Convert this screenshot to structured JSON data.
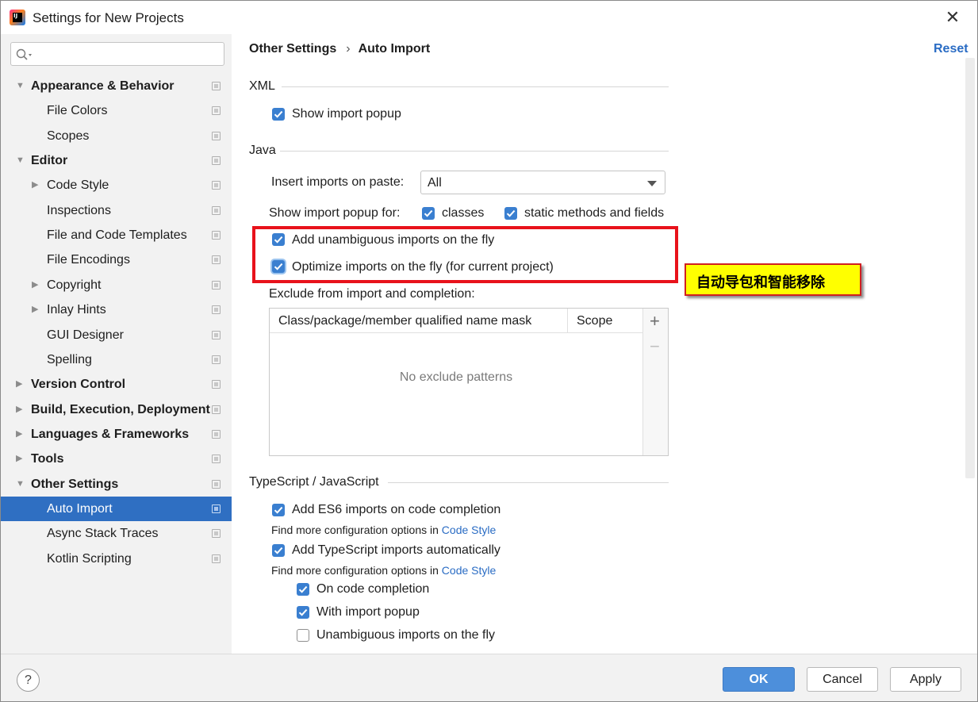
{
  "window": {
    "title": "Settings for New Projects",
    "close_glyph": "✕",
    "app_icon_text": "IJ"
  },
  "sidebar": {
    "search_placeholder": "",
    "items": [
      {
        "label": "Appearance & Behavior",
        "level": 0,
        "expanded": true
      },
      {
        "label": "File Colors",
        "level": 1
      },
      {
        "label": "Scopes",
        "level": 1
      },
      {
        "label": "Editor",
        "level": 0,
        "expanded": true
      },
      {
        "label": "Code Style",
        "level": 1,
        "collapsed": true
      },
      {
        "label": "Inspections",
        "level": 1
      },
      {
        "label": "File and Code Templates",
        "level": 1
      },
      {
        "label": "File Encodings",
        "level": 1
      },
      {
        "label": "Copyright",
        "level": 1,
        "collapsed": true
      },
      {
        "label": "Inlay Hints",
        "level": 1,
        "collapsed": true
      },
      {
        "label": "GUI Designer",
        "level": 1
      },
      {
        "label": "Spelling",
        "level": 1
      },
      {
        "label": "Version Control",
        "level": 0,
        "collapsed": true
      },
      {
        "label": "Build, Execution, Deployment",
        "level": 0,
        "collapsed": true
      },
      {
        "label": "Languages & Frameworks",
        "level": 0,
        "collapsed": true
      },
      {
        "label": "Tools",
        "level": 0,
        "collapsed": true
      },
      {
        "label": "Other Settings",
        "level": 0,
        "expanded": true
      },
      {
        "label": "Auto Import",
        "level": 1,
        "selected": true
      },
      {
        "label": "Async Stack Traces",
        "level": 1
      },
      {
        "label": "Kotlin Scripting",
        "level": 1
      }
    ]
  },
  "header": {
    "breadcrumb_parent": "Other Settings",
    "breadcrumb_sep": "›",
    "breadcrumb_current": "Auto Import",
    "reset_label": "Reset"
  },
  "xml": {
    "section_title": "XML",
    "show_import_popup": {
      "label": "Show import popup",
      "checked": true
    }
  },
  "java": {
    "section_title": "Java",
    "insert_imports_label": "Insert imports on paste:",
    "insert_imports_value": "All",
    "show_popup_for_label": "Show import popup for:",
    "classes": {
      "label": "classes",
      "checked": true
    },
    "static_methods": {
      "label": "static methods and fields",
      "checked": true
    },
    "add_unambiguous": {
      "label": "Add unambiguous imports on the fly",
      "checked": true
    },
    "optimize_imports": {
      "label": "Optimize imports on the fly (for current project)",
      "checked": true
    },
    "exclude_label": "Exclude from import and completion:",
    "table": {
      "col_name": "Class/package/member qualified name mask",
      "col_scope": "Scope",
      "empty_text": "No exclude patterns",
      "add_glyph": "+",
      "remove_glyph": "−"
    }
  },
  "annotation": {
    "callout_text": "自动导包和智能移除",
    "highlight_color": "#e8121b",
    "callout_bg": "#ffff00"
  },
  "typescript": {
    "section_title": "TypeScript / JavaScript",
    "add_es6": {
      "label": "Add ES6 imports on code completion",
      "checked": true
    },
    "find_more_1": "Find more configuration options in ",
    "code_style_link_1": "Code Style",
    "add_ts": {
      "label": "Add TypeScript imports automatically",
      "checked": true
    },
    "find_more_2": "Find more configuration options in ",
    "code_style_link_2": "Code Style",
    "on_code_completion": {
      "label": "On code completion",
      "checked": true
    },
    "with_import_popup": {
      "label": "With import popup",
      "checked": true
    },
    "unambiguous_on_fly": {
      "label": "Unambiguous imports on the fly",
      "checked": false
    }
  },
  "footer": {
    "help_label": "?",
    "ok_label": "OK",
    "cancel_label": "Cancel",
    "apply_label": "Apply"
  },
  "colors": {
    "accent": "#2f6fc2",
    "link": "#2a6cc4",
    "checkbox": "#3a7fd0",
    "ok_button": "#4d8fdb"
  }
}
